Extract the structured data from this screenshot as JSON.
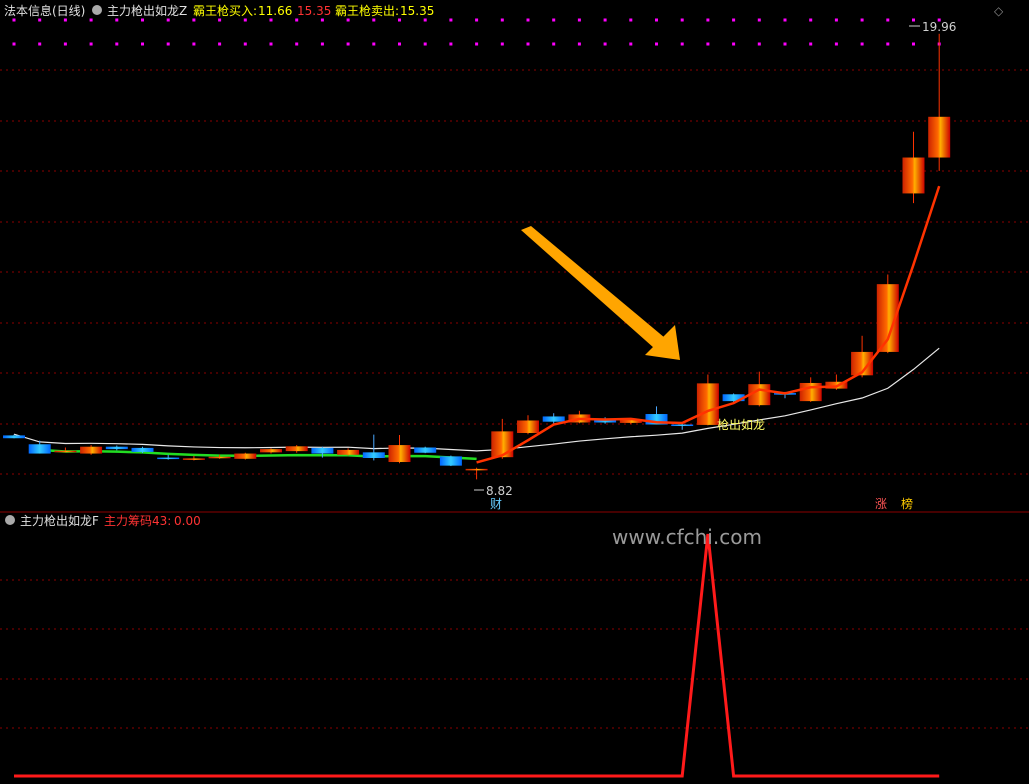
{
  "top_header": {
    "title": "法本信息(日线)",
    "indicator_name": "主力枪出如龙Z",
    "buy_label": "霸王枪买入:",
    "buy_value": "11.66",
    "sell_label_faded": "15.35",
    "sell_label": "霸王枪卖出:",
    "sell_value": "15.35"
  },
  "bottom_header": {
    "indicator_name": "主力枪出如龙F",
    "series_label": "主力筹码43:",
    "series_value": "0.00"
  },
  "watermark": "www.cfchi.com",
  "annotations": {
    "high_marker": "19.96",
    "low_marker": "8.82",
    "signal_text": "枪出如龙",
    "badge_cai": "财",
    "badge_zhang": "涨",
    "badge_bang": "榜"
  },
  "colors": {
    "background": "#000000",
    "grid": "#8b0000",
    "up_candle": "#ff2a00",
    "down_candle": "#1e90ff",
    "ma_fast": "#ff3300",
    "ma_slow": "#e8e8e8",
    "green_line": "#22dd22",
    "signal_line": "#ff1a1a",
    "marker_dot": "#ff00ff",
    "arrow": "#ffa500",
    "header_yellow": "#ffff00",
    "header_red": "#ff3333"
  },
  "chart_data": [
    {
      "type": "candlestick",
      "title": "法本信息(日线)",
      "ylim": [
        8.2,
        20.3
      ],
      "candles": [
        {
          "o": 10.0,
          "h": 10.02,
          "l": 9.93,
          "c": 9.93
        },
        {
          "o": 9.78,
          "h": 9.87,
          "l": 9.55,
          "c": 9.55
        },
        {
          "o": 9.62,
          "h": 9.7,
          "l": 9.58,
          "c": 9.62
        },
        {
          "o": 9.55,
          "h": 9.76,
          "l": 9.52,
          "c": 9.72
        },
        {
          "o": 9.72,
          "h": 9.75,
          "l": 9.63,
          "c": 9.66
        },
        {
          "o": 9.69,
          "h": 9.72,
          "l": 9.56,
          "c": 9.59
        },
        {
          "o": 9.45,
          "h": 9.52,
          "l": 9.4,
          "c": 9.42
        },
        {
          "o": 9.4,
          "h": 9.49,
          "l": 9.38,
          "c": 9.43
        },
        {
          "o": 9.46,
          "h": 9.52,
          "l": 9.42,
          "c": 9.47
        },
        {
          "o": 9.42,
          "h": 9.57,
          "l": 9.4,
          "c": 9.55
        },
        {
          "o": 9.58,
          "h": 9.68,
          "l": 9.55,
          "c": 9.66
        },
        {
          "o": 9.61,
          "h": 9.76,
          "l": 9.57,
          "c": 9.73
        },
        {
          "o": 9.69,
          "h": 9.72,
          "l": 9.45,
          "c": 9.55
        },
        {
          "o": 9.52,
          "h": 9.68,
          "l": 9.5,
          "c": 9.64
        },
        {
          "o": 9.58,
          "h": 10.02,
          "l": 9.38,
          "c": 9.44
        },
        {
          "o": 9.34,
          "h": 10.01,
          "l": 9.31,
          "c": 9.76
        },
        {
          "o": 9.7,
          "h": 9.72,
          "l": 9.56,
          "c": 9.57
        },
        {
          "o": 9.48,
          "h": 9.5,
          "l": 9.24,
          "c": 9.25
        },
        {
          "o": 9.16,
          "h": 9.2,
          "l": 8.91,
          "c": 9.17
        },
        {
          "o": 9.46,
          "h": 10.41,
          "l": 9.42,
          "c": 10.1
        },
        {
          "o": 10.06,
          "h": 10.5,
          "l": 10.03,
          "c": 10.37
        },
        {
          "o": 10.47,
          "h": 10.55,
          "l": 10.28,
          "c": 10.34
        },
        {
          "o": 10.32,
          "h": 10.61,
          "l": 10.3,
          "c": 10.52
        },
        {
          "o": 10.42,
          "h": 10.45,
          "l": 10.29,
          "c": 10.32
        },
        {
          "o": 10.31,
          "h": 10.43,
          "l": 10.28,
          "c": 10.39
        },
        {
          "o": 10.53,
          "h": 10.72,
          "l": 10.27,
          "c": 10.27
        },
        {
          "o": 10.27,
          "h": 10.29,
          "l": 10.14,
          "c": 10.26
        },
        {
          "o": 10.26,
          "h": 11.51,
          "l": 10.25,
          "c": 11.29
        },
        {
          "o": 11.02,
          "h": 11.04,
          "l": 10.83,
          "c": 10.85
        },
        {
          "o": 10.75,
          "h": 11.58,
          "l": 10.72,
          "c": 11.27
        },
        {
          "o": 11.05,
          "h": 11.08,
          "l": 10.92,
          "c": 11.01
        },
        {
          "o": 10.85,
          "h": 11.44,
          "l": 10.83,
          "c": 11.3
        },
        {
          "o": 11.16,
          "h": 11.51,
          "l": 11.13,
          "c": 11.33
        },
        {
          "o": 11.49,
          "h": 12.47,
          "l": 11.44,
          "c": 12.07
        },
        {
          "o": 12.07,
          "h": 13.99,
          "l": 12.04,
          "c": 13.75
        },
        {
          "o": 16.0,
          "h": 17.53,
          "l": 15.76,
          "c": 16.89
        },
        {
          "o": 16.89,
          "h": 19.96,
          "l": 16.56,
          "c": 17.9
        }
      ]
    },
    {
      "type": "line",
      "title": "主力筹码43",
      "x_count": 37,
      "ylim": [
        0,
        1
      ],
      "values": [
        0,
        0,
        0,
        0,
        0,
        0,
        0,
        0,
        0,
        0,
        0,
        0,
        0,
        0,
        0,
        0,
        0,
        0,
        0,
        0,
        0,
        0,
        0,
        0,
        0,
        0,
        0,
        1,
        0,
        0,
        0,
        0,
        0,
        0,
        0,
        0,
        0
      ]
    }
  ]
}
